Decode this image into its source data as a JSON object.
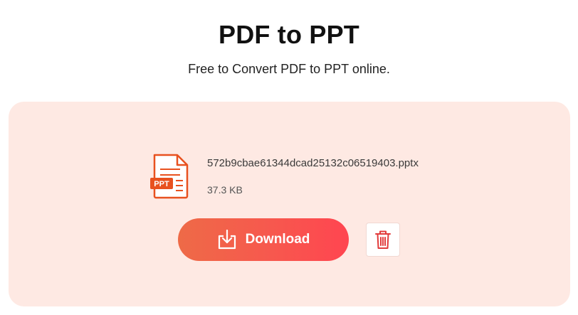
{
  "header": {
    "title": "PDF to PPT",
    "subtitle": "Free to Convert PDF to PPT online."
  },
  "file": {
    "icon": "ppt-file-icon",
    "badge": "PPT",
    "name": "572b9cbae61344dcad25132c06519403.pptx",
    "size": "37.3 KB"
  },
  "actions": {
    "download_label": "Download",
    "download_icon": "download-icon",
    "delete_icon": "trash-icon"
  },
  "colors": {
    "accent": "#f7584e",
    "panel_bg": "#fee9e3",
    "icon_orange": "#e8511f",
    "trash_red": "#e23b3b"
  }
}
